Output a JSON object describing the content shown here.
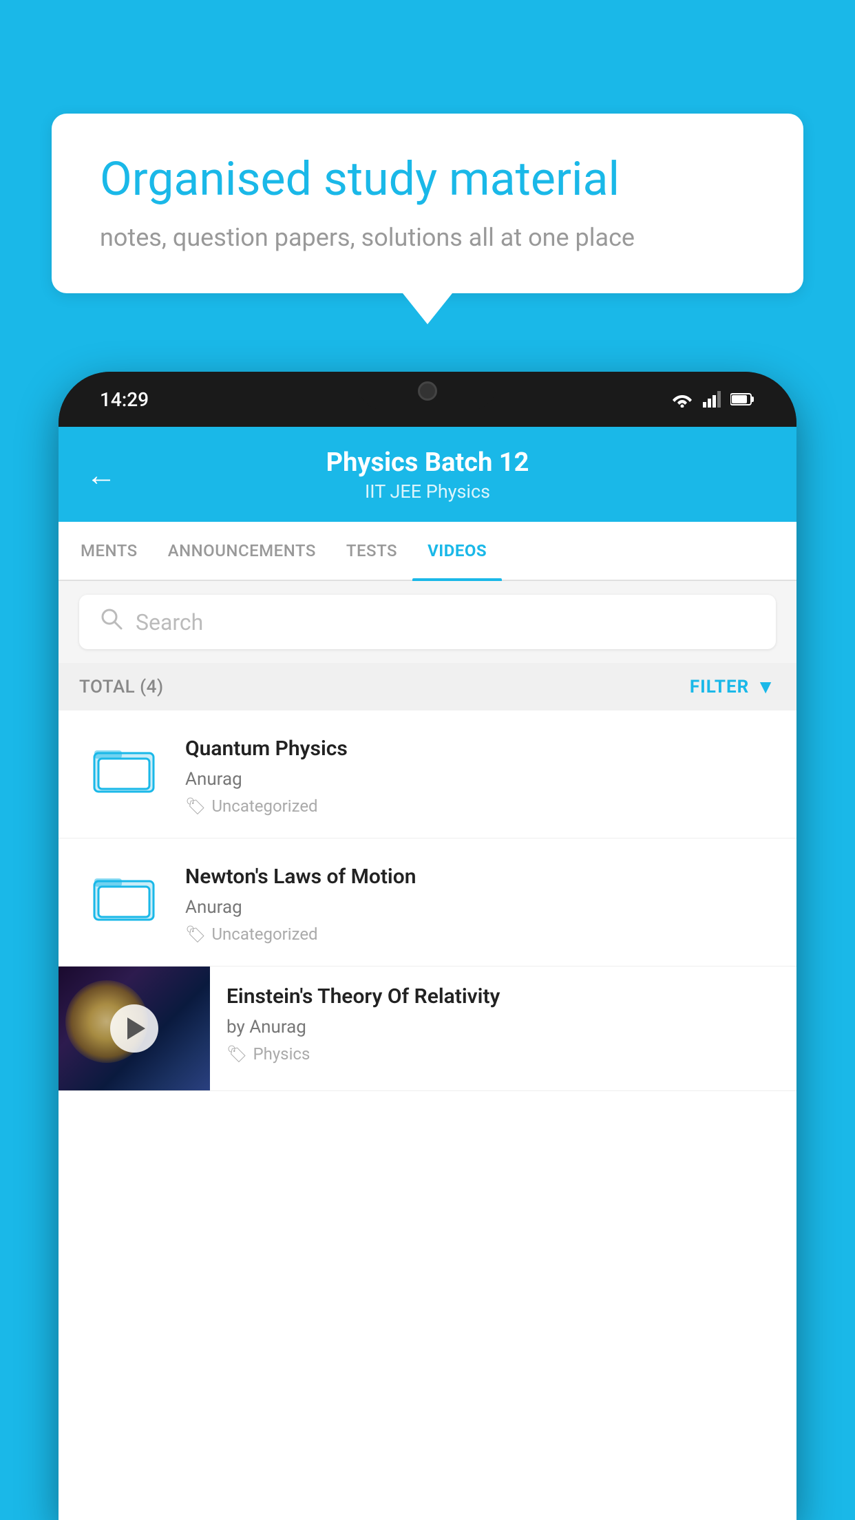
{
  "background": {
    "color": "#1ab8e8"
  },
  "bubble": {
    "title": "Organised study material",
    "subtitle": "notes, question papers, solutions all at one place"
  },
  "status_bar": {
    "time": "14:29",
    "icons": [
      "wifi",
      "signal",
      "battery"
    ]
  },
  "header": {
    "title": "Physics Batch 12",
    "subtitle": "IIT JEE   Physics",
    "back_label": "←"
  },
  "tabs": [
    {
      "label": "MENTS",
      "active": false
    },
    {
      "label": "ANNOUNCEMENTS",
      "active": false
    },
    {
      "label": "TESTS",
      "active": false
    },
    {
      "label": "VIDEOS",
      "active": true
    }
  ],
  "search": {
    "placeholder": "Search"
  },
  "filter": {
    "total_label": "TOTAL (4)",
    "filter_label": "FILTER"
  },
  "videos": [
    {
      "id": 1,
      "title": "Quantum Physics",
      "author": "Anurag",
      "tag": "Uncategorized",
      "has_thumbnail": false
    },
    {
      "id": 2,
      "title": "Newton's Laws of Motion",
      "author": "Anurag",
      "tag": "Uncategorized",
      "has_thumbnail": false
    },
    {
      "id": 3,
      "title": "Einstein's Theory Of Relativity",
      "author": "by Anurag",
      "tag": "Physics",
      "has_thumbnail": true
    }
  ]
}
